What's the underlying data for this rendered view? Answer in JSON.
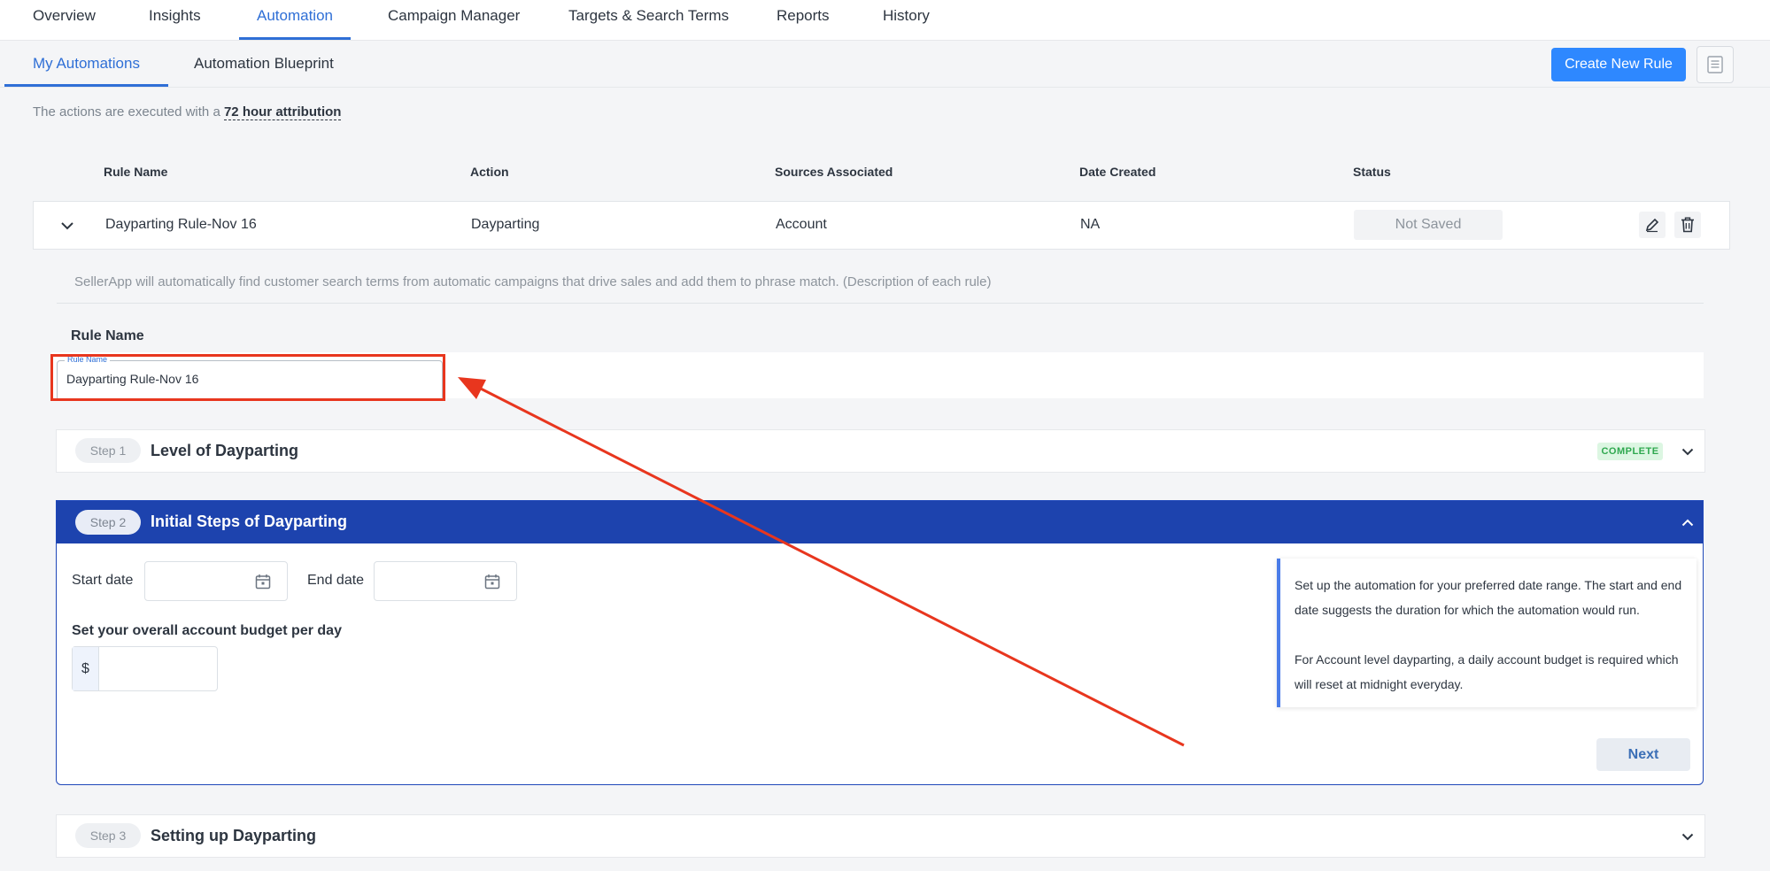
{
  "top_tabs": [
    "Overview",
    "Insights",
    "Automation",
    "Campaign Manager",
    "Targets & Search Terms",
    "Reports",
    "History"
  ],
  "active_top_tab": "Automation",
  "sub_tabs": [
    "My Automations",
    "Automation Blueprint"
  ],
  "active_sub_tab": "My Automations",
  "toolbar": {
    "create_label": "Create New Rule",
    "doc_icon": "document-icon"
  },
  "attribution": {
    "prefix": "The actions are executed with a",
    "value": "72 hour attribution"
  },
  "table": {
    "headers": [
      "Rule Name",
      "Action",
      "Sources Associated",
      "Date Created",
      "Status"
    ],
    "row": {
      "rule_name": "Dayparting Rule-Nov 16",
      "action": "Dayparting",
      "sources": "Account",
      "date_created": "NA",
      "status": "Not Saved"
    }
  },
  "description": "SellerApp will automatically find customer search terms from automatic campaigns that drive sales and add them to phrase match. (Description of each rule)",
  "rule_name_section": {
    "label": "Rule Name",
    "field_label": "Rule Name",
    "value": "Dayparting Rule-Nov 16"
  },
  "steps": [
    {
      "pill": "Step 1",
      "title": "Level of Dayparting",
      "badge": "COMPLETE"
    },
    {
      "pill": "Step 2",
      "title": "Initial Steps of Dayparting"
    },
    {
      "pill": "Step 3",
      "title": "Setting up Dayparting"
    }
  ],
  "step2": {
    "start_label": "Start date",
    "end_label": "End date",
    "budget_label": "Set your overall account budget per day",
    "currency": "$",
    "info_line1": "Set up the automation for your preferred date range. The start and end date suggests the duration for which the automation would run.",
    "info_line2": "For Account level dayparting, a daily account budget is required which will reset at midnight everyday.",
    "next_label": "Next"
  },
  "colors": {
    "accent": "#2f6fd6",
    "primary_button": "#2e88ff",
    "step_header": "#1d43ae",
    "annotation": "#e8361e",
    "complete": "#2fa84f"
  }
}
